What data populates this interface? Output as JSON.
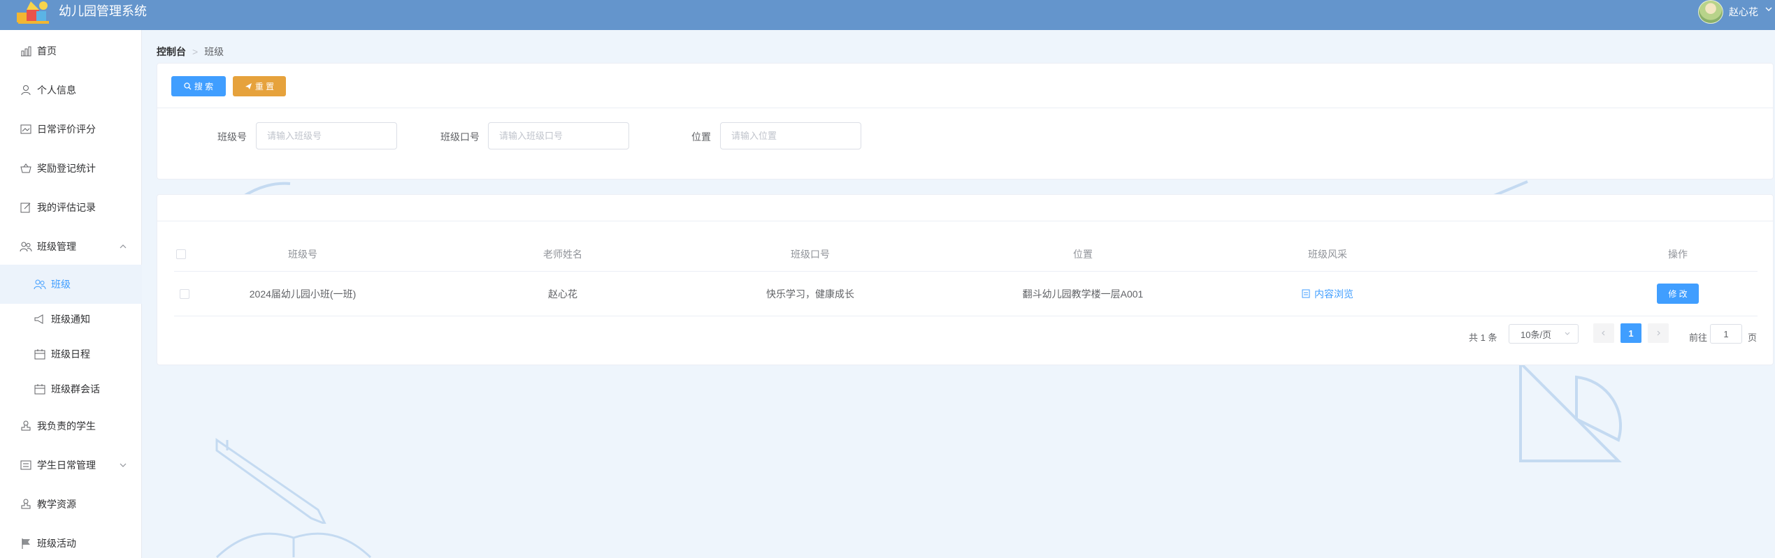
{
  "app": {
    "title": "幼儿园管理系统"
  },
  "user": {
    "name": "赵心花"
  },
  "sidebar": {
    "items": [
      {
        "label": "首页",
        "icon": "chart-icon"
      },
      {
        "label": "个人信息",
        "icon": "user-icon"
      },
      {
        "label": "日常评价评分",
        "icon": "picture-icon"
      },
      {
        "label": "奖励登记统计",
        "icon": "basket-icon"
      },
      {
        "label": "我的评估记录",
        "icon": "edit-icon"
      },
      {
        "label": "班级管理",
        "icon": "group-icon",
        "expanded": true
      },
      {
        "label": "班级",
        "icon": "group-icon",
        "active": true
      },
      {
        "label": "班级通知",
        "icon": "megaphone-icon"
      },
      {
        "label": "班级日程",
        "icon": "calendar-icon"
      },
      {
        "label": "班级群会话",
        "icon": "calendar-icon"
      },
      {
        "label": "我负责的学生",
        "icon": "stamp-icon"
      },
      {
        "label": "学生日常管理",
        "icon": "list-icon",
        "expanded": false
      },
      {
        "label": "教学资源",
        "icon": "stamp-icon"
      },
      {
        "label": "班级活动",
        "icon": "flag-icon"
      }
    ]
  },
  "breadcrumb": {
    "home": "控制台",
    "current": "班级"
  },
  "search": {
    "search_label": "搜 索",
    "reset_label": "重 置",
    "fields": [
      {
        "label": "班级号",
        "placeholder": "请输入班级号"
      },
      {
        "label": "班级口号",
        "placeholder": "请输入班级口号"
      },
      {
        "label": "位置",
        "placeholder": "请输入位置"
      }
    ]
  },
  "table": {
    "columns": [
      "班级号",
      "老师姓名",
      "班级口号",
      "位置",
      "班级风采",
      "操作"
    ],
    "rows": [
      {
        "class_no": "2024届幼儿园小班(一班)",
        "teacher": "赵心花",
        "slogan": "快乐学习，健康成长",
        "location": "翻斗幼儿园教学楼一层A001",
        "style_link": "内容浏览",
        "action": "修 改"
      }
    ]
  },
  "pager": {
    "total": "共 1 条",
    "page_size": "10条/页",
    "current_page": "1",
    "goto_label": "前往",
    "goto_value": "1",
    "page_suffix": "页"
  },
  "colors": {
    "header": "#6495cc",
    "primary": "#409eff",
    "warning": "#e6a23c"
  }
}
